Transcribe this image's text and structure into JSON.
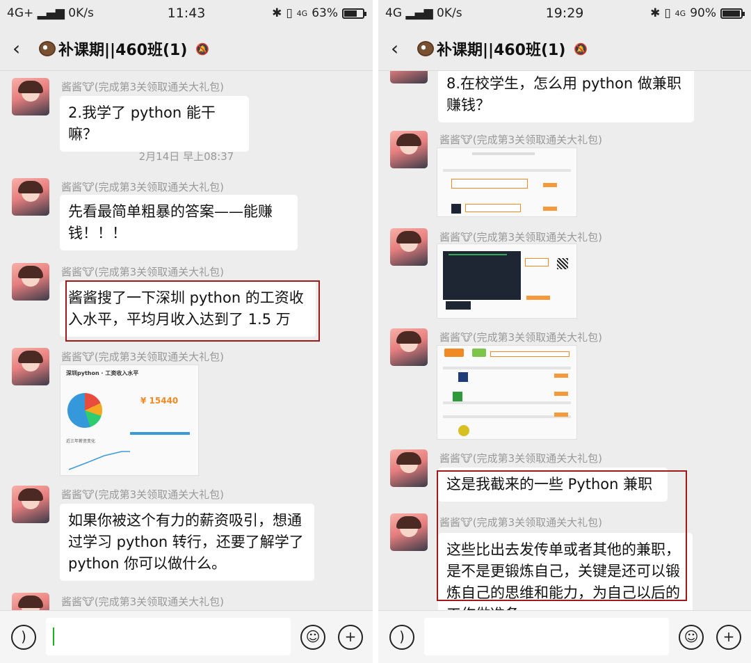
{
  "left": {
    "status": {
      "network": "4G+",
      "speed": "0K/s",
      "time": "11:43",
      "signal": "4G",
      "battery": "63%",
      "battery_level": 0.63
    },
    "title": "补课期||460班(1)",
    "messages": [
      {
        "nick": "酱酱🐮(完成第3关领取通关大礼包)",
        "text": "2.我学了 python 能干嘛？"
      },
      {
        "timestamp": "2月14日 早上08:37"
      },
      {
        "nick": "酱酱🐮(完成第3关领取通关大礼包)",
        "text": "先看最简单粗暴的答案——能赚钱！！！"
      },
      {
        "nick": "酱酱🐮(完成第3关领取通关大礼包)",
        "text": "酱酱搜了一下深圳 python 的工资收入水平，平均月收入达到了 1.5 万"
      },
      {
        "nick": "酱酱🐮(完成第3关领取通关大礼包)",
        "image": {
          "title": "深圳python · 工资收入水平",
          "value": "¥ 15440",
          "section": "近三年薪资变化"
        }
      },
      {
        "nick": "酱酱🐮(完成第3关领取通关大礼包)",
        "text": "如果你被这个有力的薪资吸引，想通过学习 python 转行，还要了解学了 python 你可以做什么。"
      },
      {
        "nick": "酱酱🐮(完成第3关领取通关大礼包)"
      }
    ]
  },
  "right": {
    "status": {
      "network": "4G",
      "speed": "0K/s",
      "time": "19:29",
      "signal": "4G",
      "battery": "90%",
      "battery_level": 0.9
    },
    "title": "补课期||460班(1)",
    "messages": [
      {
        "text": "8.在校学生，怎么用 python 做兼职赚钱？"
      },
      {
        "nick": "酱酱🐮(完成第3关领取通关大礼包)",
        "image": "screenshot-1"
      },
      {
        "nick": "酱酱🐮(完成第3关领取通关大礼包)",
        "image": "screenshot-2"
      },
      {
        "nick": "酱酱🐮(完成第3关领取通关大礼包)",
        "image": "screenshot-3"
      },
      {
        "nick": "酱酱🐮(完成第3关领取通关大礼包)",
        "text": "这是我截来的一些 Python 兼职"
      },
      {
        "nick": "酱酱🐮(完成第3关领取通关大礼包)",
        "text": "这些比出去发传单或者其他的兼职，是不是更锻炼自己，关键是还可以锻炼自己的思维和能力，为自己以后的工作做准备"
      }
    ]
  },
  "icons": {
    "back": "chevron-left-icon",
    "mute": "bell-off-icon",
    "voice": "voice-icon",
    "emoji": "emoji-icon",
    "plus": "plus-icon"
  },
  "colors": {
    "highlight_border": "#a01818",
    "cursor": "#17b317",
    "price": "#f08a24"
  }
}
